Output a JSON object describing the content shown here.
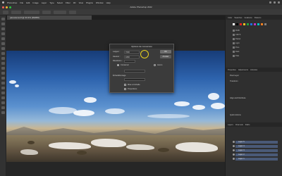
{
  "menubar": {
    "items": [
      "Photoshop",
      "File",
      "Edit",
      "Image",
      "Layer",
      "Type",
      "Select",
      "Filter",
      "3D",
      "View",
      "Plugins",
      "Window",
      "Help"
    ]
  },
  "window": {
    "title": "Adobe Photoshop 2022"
  },
  "document": {
    "tab_label": "panorama.tif @ 33.3% (RGB/8)"
  },
  "dialog": {
    "title": "Options de conversion",
    "field1_label": "Largeur :",
    "field1_value": "7000",
    "field2_label": "Hauteur :",
    "field2_value": "1800",
    "field3_label": "Résolution :",
    "ok_label": "OK",
    "cancel_label": "Annuler",
    "option1": "Conserver",
    "option2": "Aucun",
    "option3": "Échantillonnage",
    "option4": "Mise à l'échelle",
    "option5": "Proportions"
  },
  "panels": {
    "top_tabs": [
      "Color",
      "Swatches",
      "Gradients",
      "Patterns"
    ],
    "swatch_colors": [
      "#ffffff",
      "#000000",
      "#e02020",
      "#f0c020",
      "#20a040",
      "#2070e0",
      "#c030c0",
      "#00c0c0",
      "#f08020",
      "#808080"
    ],
    "library_items": [
      "RGB",
      "CMYK",
      "Pastel",
      "Light",
      "Pure",
      "Dark",
      "Pale"
    ],
    "mid_tabs": [
      "Properties",
      "Adjustments",
      "Libraries"
    ],
    "properties_labels": [
      "Pixel Layer",
      "Transform",
      "Align and Distribute",
      "Quick Actions"
    ],
    "layers_tabs": [
      "Layers",
      "Channels",
      "Paths"
    ],
    "layers": [
      "Layer 5",
      "Layer 4",
      "Layer 3",
      "Layer 2",
      "Layer 1"
    ]
  },
  "colors": {
    "accent": "#e8d21e",
    "layer_selected": "#4a5a78"
  }
}
